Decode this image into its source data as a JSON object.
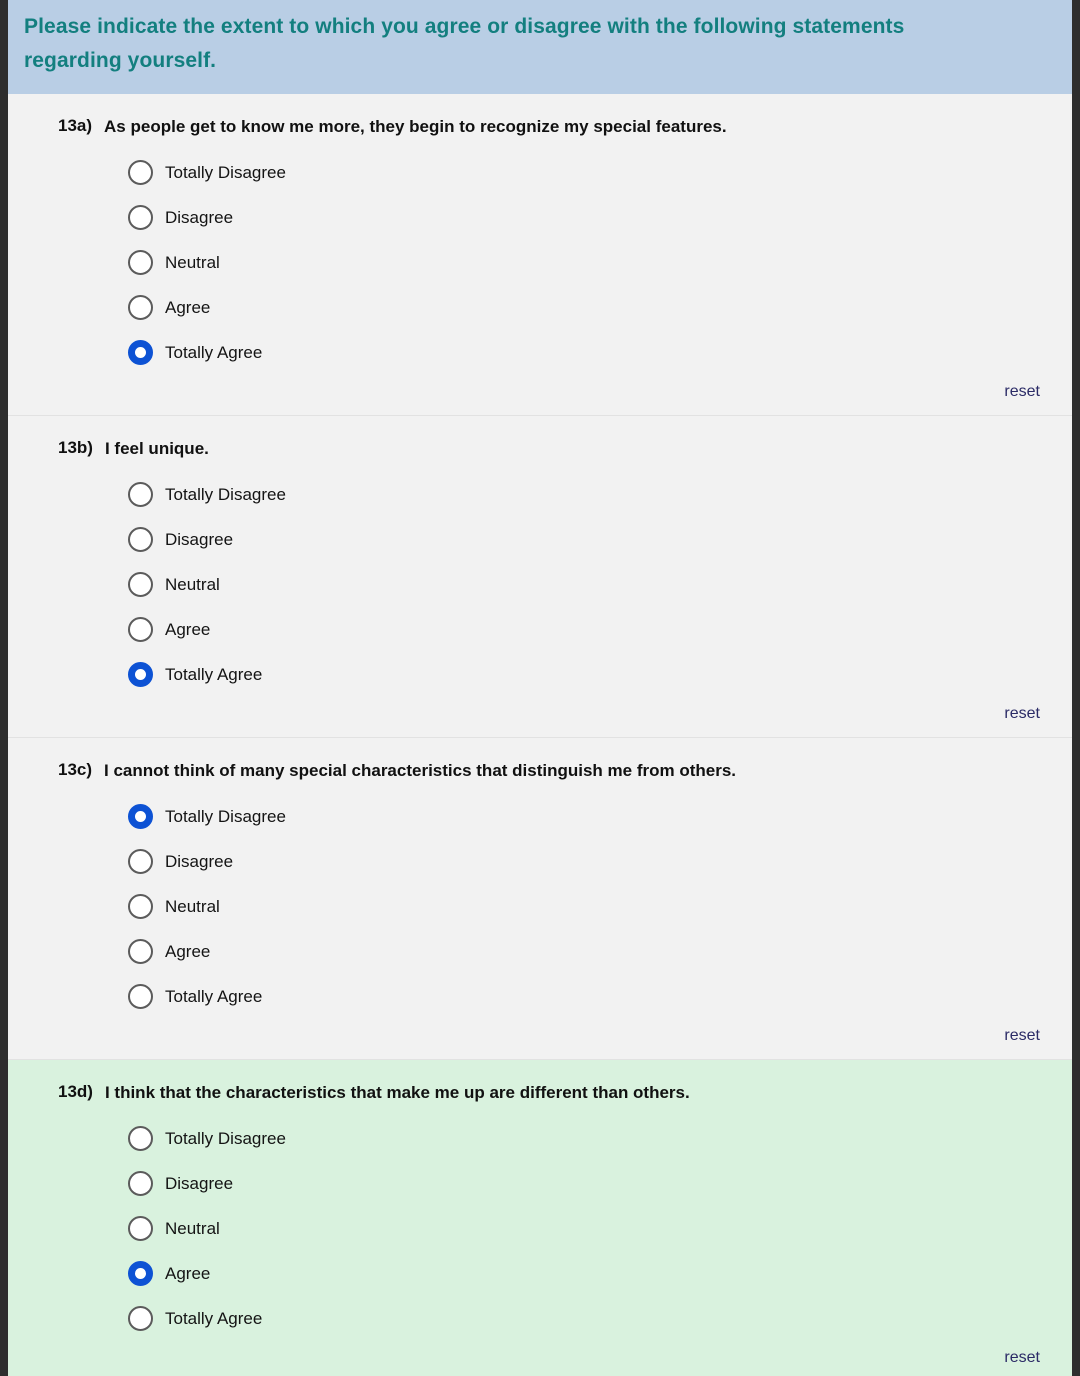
{
  "banner": {
    "title": "Please indicate the extent to which you agree or disagree with the following statements regarding yourself.",
    "background_color": "#b9cee5",
    "text_color": "#137f7f"
  },
  "theme": {
    "page_background": "#f2f2f2",
    "highlight_background": "#d9f2de",
    "radio_selected_color": "#0d52d4",
    "radio_border_color": "#5b5b5b",
    "reset_link_color": "#2b2b66",
    "frame_color": "#2e2e2e",
    "separator_color": "#e2e2e2"
  },
  "scale": {
    "options": [
      "Totally Disagree",
      "Disagree",
      "Neutral",
      "Agree",
      "Totally Agree"
    ]
  },
  "questions": [
    {
      "number": "13a)",
      "text": "As people get to know me more, they begin to recognize my special features.",
      "options": [
        "Totally Disagree",
        "Disagree",
        "Neutral",
        "Agree",
        "Totally Agree"
      ],
      "selected_index": 4,
      "selected_value": "Totally Agree",
      "reset_label": "reset",
      "highlighted": false
    },
    {
      "number": "13b)",
      "text": "I feel unique.",
      "options": [
        "Totally Disagree",
        "Disagree",
        "Neutral",
        "Agree",
        "Totally Agree"
      ],
      "selected_index": 4,
      "selected_value": "Totally Agree",
      "reset_label": "reset",
      "highlighted": false
    },
    {
      "number": "13c)",
      "text": "I cannot think of many special characteristics that distinguish me from others.",
      "options": [
        "Totally Disagree",
        "Disagree",
        "Neutral",
        "Agree",
        "Totally Agree"
      ],
      "selected_index": 0,
      "selected_value": "Totally Disagree",
      "reset_label": "reset",
      "highlighted": false
    },
    {
      "number": "13d)",
      "text": "I think that the characteristics that make me up are different than others.",
      "options": [
        "Totally Disagree",
        "Disagree",
        "Neutral",
        "Agree",
        "Totally Agree"
      ],
      "selected_index": 3,
      "selected_value": "Agree",
      "reset_label": "reset",
      "highlighted": true
    }
  ]
}
